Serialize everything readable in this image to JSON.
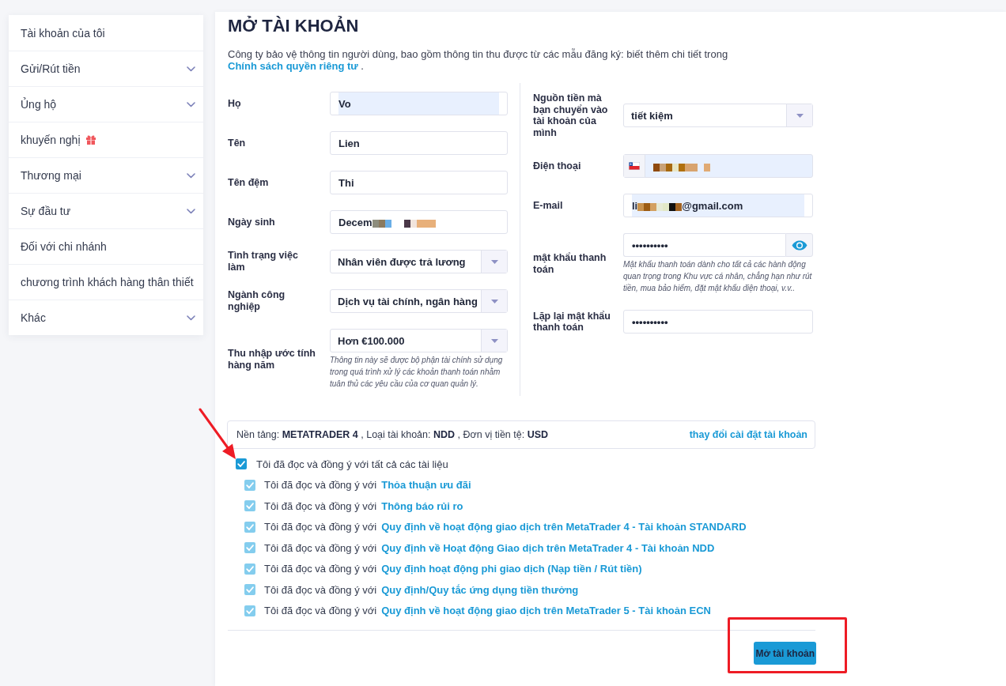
{
  "sidebar": {
    "items": [
      {
        "label": "Tài khoản của tôi",
        "kind": "link"
      },
      {
        "label": "Gửi/Rút tiền",
        "kind": "menu"
      },
      {
        "label": "Ủng hộ",
        "kind": "menu"
      },
      {
        "label": "khuyến nghị",
        "kind": "promo"
      },
      {
        "label": "Thương mại",
        "kind": "menu"
      },
      {
        "label": "Sự đầu tư",
        "kind": "menu"
      },
      {
        "label": "Đối với chi nhánh",
        "kind": "link"
      },
      {
        "label": "chương trình khách hàng thân thiết",
        "kind": "link"
      },
      {
        "label": "Khác",
        "kind": "menu"
      }
    ]
  },
  "page": {
    "title": "MỞ TÀI KHOẢN",
    "intro": {
      "text": "Công ty bảo vệ thông tin người dùng, bao gồm thông tin thu được từ các mẫu đăng ký: biết thêm chi tiết trong",
      "link": "Chính sách quyền riêng tư",
      "after": "."
    }
  },
  "form": {
    "left_fields": [
      {
        "label": "Họ",
        "kind": "text",
        "value": "Vo",
        "autofilled": true
      },
      {
        "label": "Tên",
        "kind": "text",
        "value": "Lien",
        "autofilled": false
      },
      {
        "label": "Tên đệm",
        "kind": "text",
        "value": "Thi",
        "autofilled": false
      },
      {
        "label": "Ngày sinh",
        "kind": "text",
        "value_parts": [
          {
            "kind": "text",
            "text": "Decem"
          },
          {
            "kind": "redacted"
          }
        ],
        "autofilled": false
      },
      {
        "label": "Tình trạng việc làm",
        "kind": "select",
        "value": "Nhân viên được trả lương"
      },
      {
        "label": "Ngành công nghiệp",
        "kind": "select",
        "value": "Dịch vụ tài chính, ngân hàng"
      },
      {
        "label": "Thu nhập ước tính hàng năm",
        "kind": "select",
        "value": "Hơn €100.000",
        "hint": "Thông tin này sẽ được bộ phận tài chính sử dụng trong quá trình xử lý các khoản thanh toán nhằm tuân thủ các yêu cầu của cơ quan quản lý."
      }
    ],
    "right_fields": [
      {
        "label": "Nguồn tiền mà bạn chuyển vào tài khoản của mình",
        "kind": "select",
        "value": "tiết kiệm"
      },
      {
        "label": "Điện thoại",
        "kind": "phone",
        "value_parts": [
          {
            "kind": "redacted"
          }
        ],
        "autofilled": true
      },
      {
        "label": "E-mail",
        "kind": "text",
        "value_parts": [
          {
            "kind": "text",
            "text": "li"
          },
          {
            "kind": "redacted"
          },
          {
            "kind": "text",
            "text": "@gmail.com"
          }
        ],
        "autofilled": true
      },
      {
        "label": "mật khẩu thanh toán",
        "kind": "password",
        "value": "••••••••••",
        "reveal_button": true,
        "hint": "Mật khẩu thanh toán dành cho tất cả các hành động quan trọng trong Khu vực cá nhân, chẳng hạn như rút tiền, mua bảo hiểm, đặt mật khẩu điện thoại, v.v.."
      },
      {
        "label": "Lặp lại mật khẩu thanh toán",
        "kind": "password",
        "value": "••••••••••",
        "reveal_button": false
      }
    ]
  },
  "account_summary": {
    "text": "Nền tảng: **METATRADER 4** , Loại tài khoản: **NDD** , Đơn vị tiền tệ: **USD**",
    "link": "thay đổi cài đặt tài khoản"
  },
  "agreements": {
    "all": {
      "label": "Tôi đã đọc và đồng ý với tất cả các tài liệu",
      "checked": true
    },
    "items": [
      {
        "prefix": "Tôi đã đọc và đồng ý với",
        "link": "Thỏa thuận ưu đãi",
        "checked": true,
        "disabled": true
      },
      {
        "prefix": "Tôi đã đọc và đồng ý với",
        "link": "Thông báo rủi ro",
        "checked": true,
        "disabled": true
      },
      {
        "prefix": "Tôi đã đọc và đồng ý với",
        "link": "Quy định về hoạt động giao dịch trên MetaTrader 4 - Tài khoản STANDARD",
        "checked": true,
        "disabled": true
      },
      {
        "prefix": "Tôi đã đọc và đồng ý với",
        "link": "Quy định về Hoạt động Giao dịch trên MetaTrader 4 - Tài khoản NDD",
        "checked": true,
        "disabled": true
      },
      {
        "prefix": "Tôi đã đọc và đồng ý với",
        "link": "Quy định hoạt động phi giao dịch (Nạp tiền / Rút tiền)",
        "checked": true,
        "disabled": true
      },
      {
        "prefix": "Tôi đã đọc và đồng ý với",
        "link": "Quy định/Quy tắc ứng dụng tiền thưởng",
        "checked": true,
        "disabled": true
      },
      {
        "prefix": "Tôi đã đọc và đồng ý với",
        "link": "Quy định về hoạt động giao dịch trên MetaTrader 5 - Tài khoản ECN",
        "checked": true,
        "disabled": true
      }
    ]
  },
  "submit_button": "Mở tài khoản",
  "annotations": [
    {
      "kind": "arrow"
    },
    {
      "kind": "frame"
    }
  ]
}
